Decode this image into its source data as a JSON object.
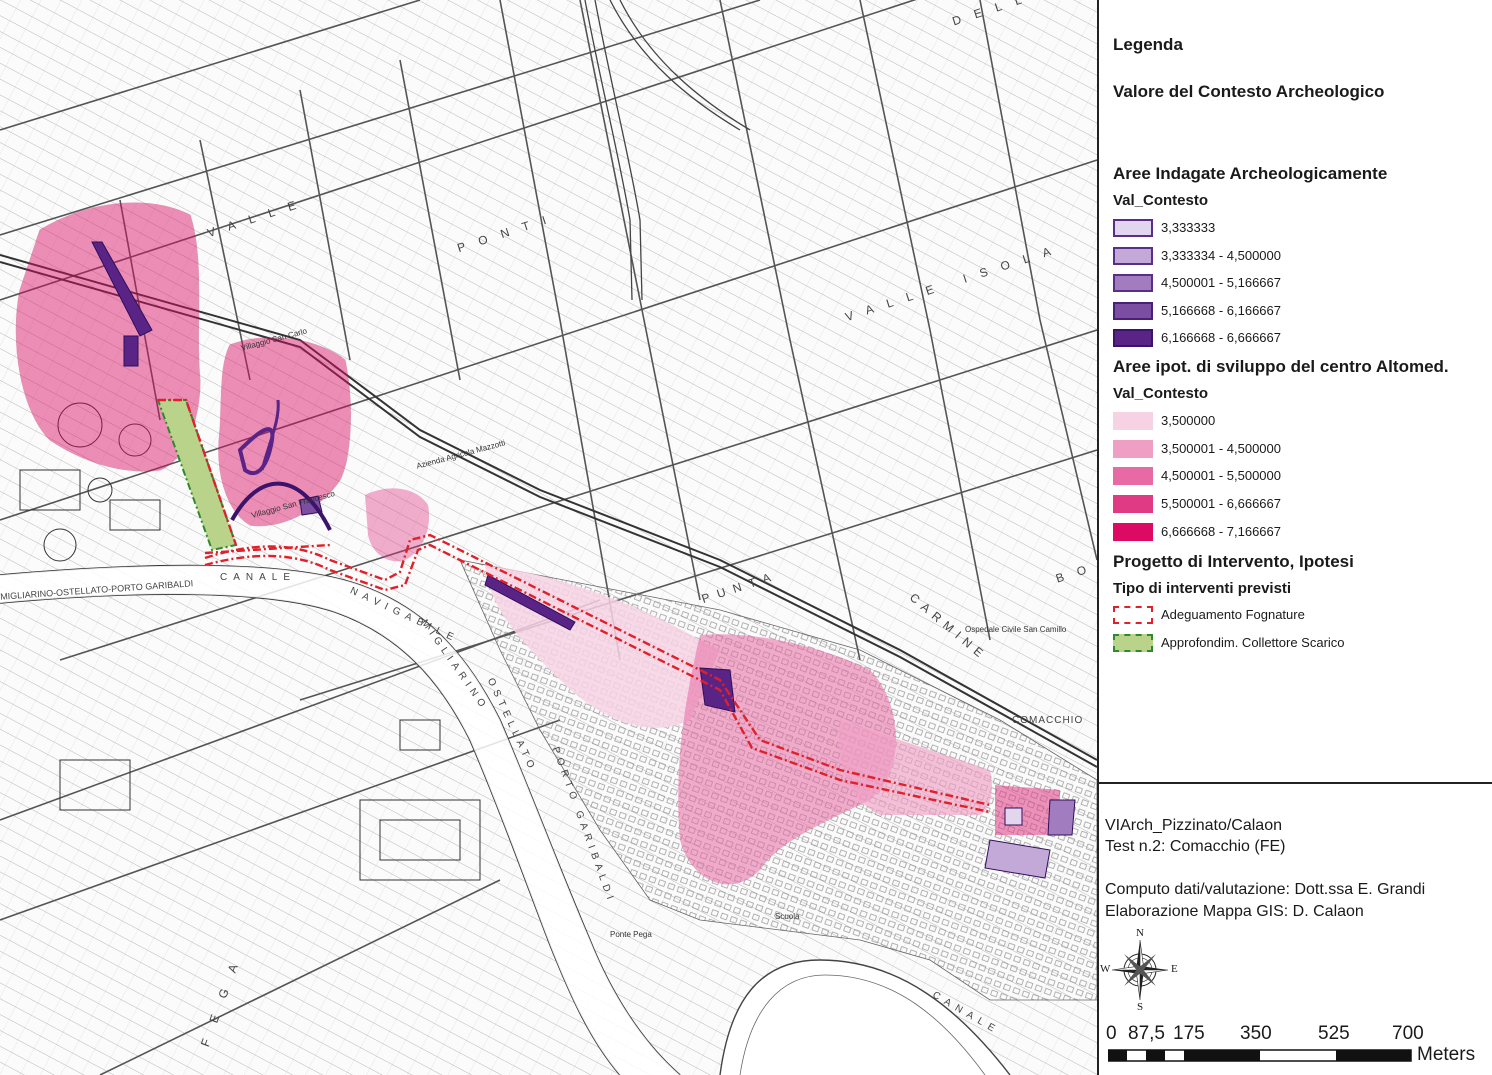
{
  "map": {
    "labels": {
      "valle": "VALLE",
      "ponti": "PONTI",
      "valle_isola": "VALLE ISOLA",
      "canale": "CANALE",
      "navigabile": "NAVIGABILE",
      "migliarino": "MIGLIARINO",
      "ostellato": "OSTELLATO",
      "porto_garibaldi": "PORTO GARIBALDI",
      "road_name": "MIGLIARINO-OSTELLATO-PORTO GARIBALDI",
      "comacchio": "COMACCHIO",
      "punta": "PUNTA",
      "carmine": "CARMINE",
      "della": "DELLA",
      "bo": "BO",
      "canale_south": "CANALE",
      "fega": "FEGA"
    },
    "place_names": {
      "villaggio_san_carlo": "Villaggio San Carlo",
      "villaggio_san_francesco": "Villaggio San Francesco",
      "azienda_mazzotti": "Azienda Agricola Mazzotti",
      "ospedale": "Ospedale Civile San Camillo",
      "scuola": "Scuola",
      "ponte_pega": "Ponte Pega"
    }
  },
  "legend": {
    "title": "Legenda",
    "subtitle": "Valore del Contesto Archeologico",
    "group1": {
      "title": "Aree Indagate Archeologicamente",
      "field": "Val_Contesto",
      "items": [
        {
          "label": "3,333333",
          "color": "#e2d6ee",
          "border": "#5a2d88"
        },
        {
          "label": "3,333334 - 4,500000",
          "color": "#c3a9d8",
          "border": "#5a2d88"
        },
        {
          "label": "4,500001 - 5,166667",
          "color": "#a17cbf",
          "border": "#5a2d88"
        },
        {
          "label": "5,166668 - 6,166667",
          "color": "#7c4ea2",
          "border": "#4a1f78"
        },
        {
          "label": "6,166668 - 6,666667",
          "color": "#5a2487",
          "border": "#3d126a"
        }
      ]
    },
    "group2": {
      "title": "Aree ipot. di sviluppo del centro Altomed.",
      "field": "Val_Contesto",
      "items": [
        {
          "label": "3,500000",
          "color": "#f7d2e4"
        },
        {
          "label": "3,500001 - 4,500000",
          "color": "#ef9fc4"
        },
        {
          "label": "4,500001 - 5,500000",
          "color": "#e76aa4"
        },
        {
          "label": "5,500001 - 6,666667",
          "color": "#e03a85"
        },
        {
          "label": "6,666668 - 7,166667",
          "color": "#dc0a63"
        }
      ]
    },
    "group3": {
      "title": "Progetto di Intervento, Ipotesi",
      "field": "Tipo di interventi previsti",
      "items": [
        {
          "label": "Adeguamento Fognature",
          "color": "#ffffff",
          "border": "#e0202a"
        },
        {
          "label": "Approfondim. Collettore Scarico",
          "color": "#b9d48a",
          "border": "#2f8a2f"
        }
      ]
    }
  },
  "credits": {
    "line1": "VIArch_Pizzinato/Calaon",
    "line2": "Test n.2: Comacchio (FE)",
    "line3": "Computo dati/valutazione: Dott.ssa E. Grandi",
    "line4": "Elaborazione Mappa GIS: D. Calaon"
  },
  "compass": {
    "n": "N",
    "s": "S",
    "e": "E",
    "w": "W"
  },
  "scale": {
    "ticks": [
      "0",
      "87,5",
      "175",
      "350",
      "525",
      "700"
    ],
    "unit": "Meters"
  }
}
